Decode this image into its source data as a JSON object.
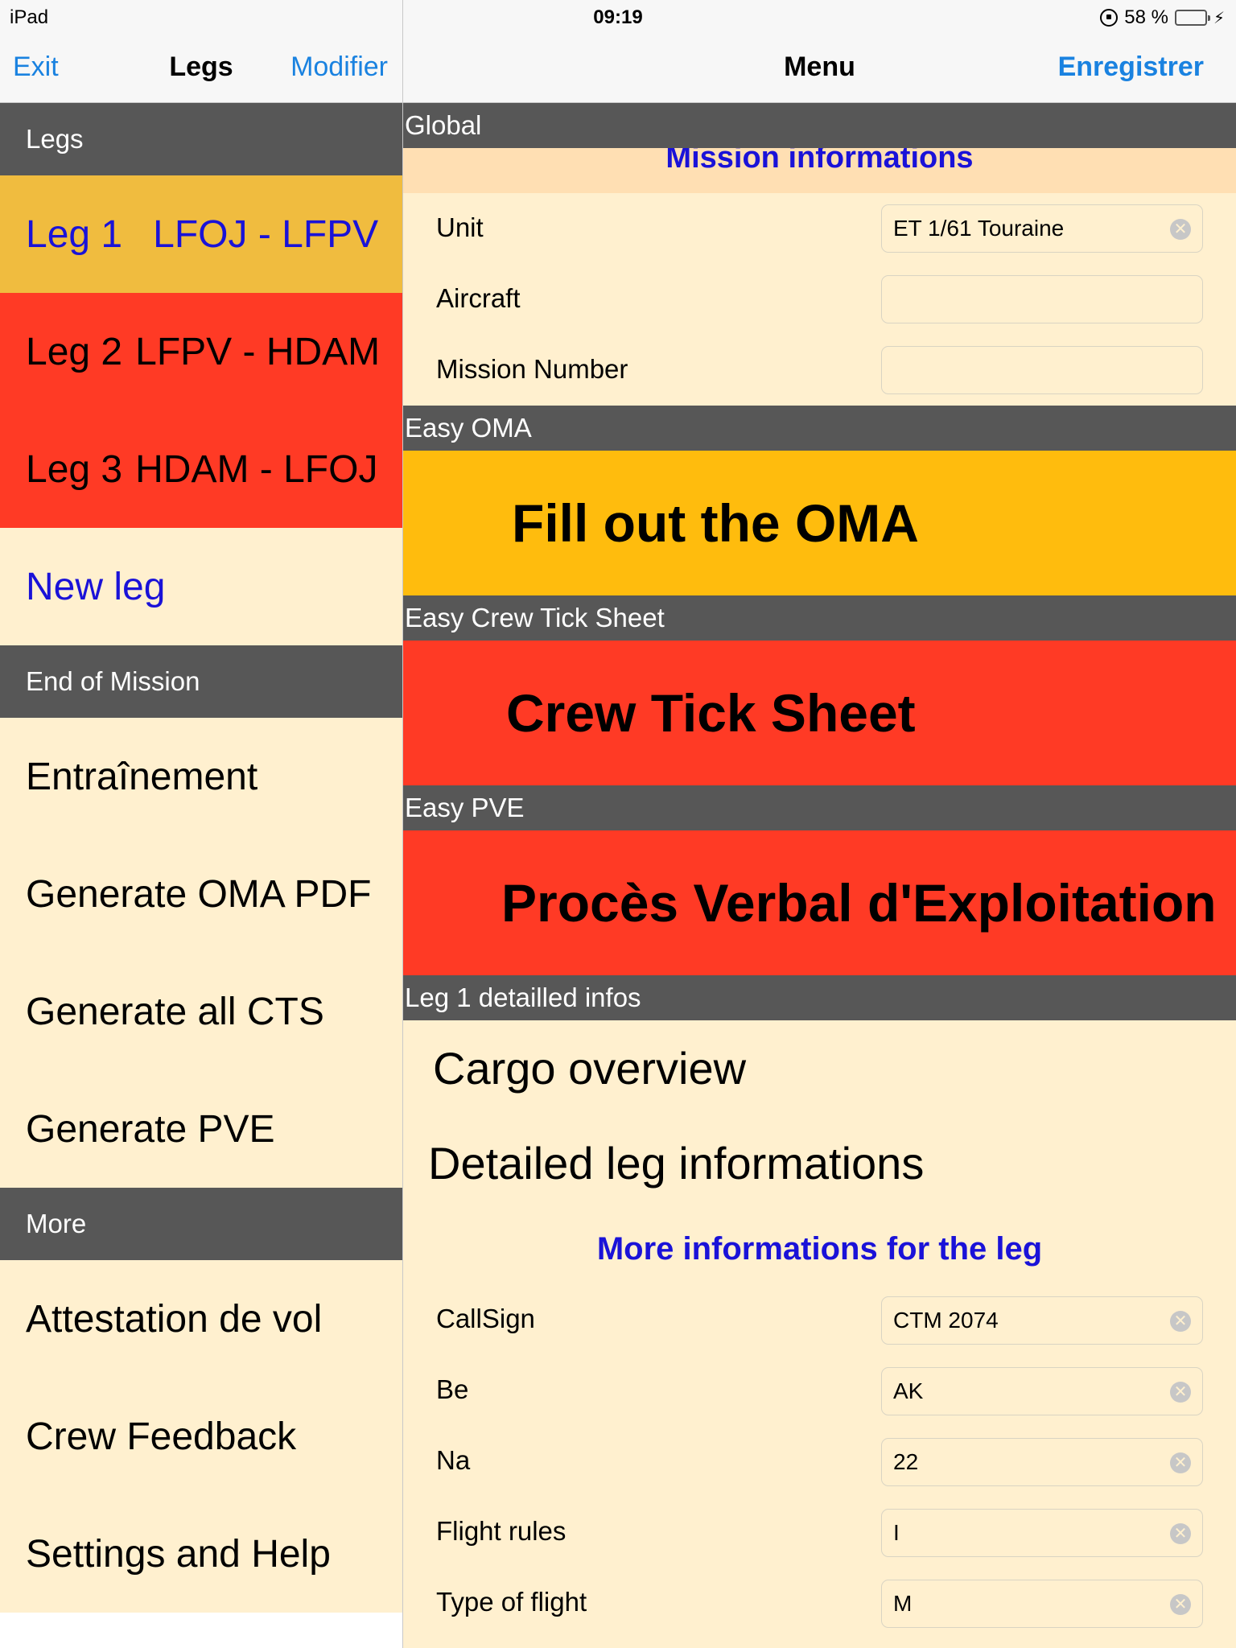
{
  "status": {
    "device": "iPad",
    "time": "09:19",
    "battery": "58 %"
  },
  "left_nav": {
    "exit": "Exit",
    "title": "Legs",
    "modify": "Modifier"
  },
  "right_nav": {
    "title": "Menu",
    "save": "Enregistrer"
  },
  "left": {
    "legs_header": "Legs",
    "legs": [
      {
        "num": "Leg 1",
        "route": "LFOJ - LFPV",
        "status_color": "#f0bc3f"
      },
      {
        "num": "Leg 2",
        "route": "LFPV - HDAM",
        "status_color": "#ff3a25"
      },
      {
        "num": "Leg 3",
        "route": "HDAM - LFOJ",
        "status_color": "#ff3a25"
      }
    ],
    "new_leg": "New leg",
    "end_header": "End of Mission",
    "end_items": [
      "Entraînement",
      "Generate OMA PDF",
      "Generate all CTS",
      "Generate PVE"
    ],
    "more_header": "More",
    "more_items": [
      "Attestation de vol",
      "Crew Feedback",
      "Settings and Help"
    ]
  },
  "right": {
    "global_header": "Global",
    "mission_title": "Mission informations",
    "unit_label": "Unit",
    "unit_value": "ET 1/61 Touraine",
    "aircraft_label": "Aircraft",
    "aircraft_value": "",
    "mission_number_label": "Mission Number",
    "mission_number_value": "",
    "oma_header": "Easy OMA",
    "oma_button": "Fill out the OMA",
    "cts_header": "Easy Crew Tick Sheet",
    "cts_button": "Crew Tick Sheet",
    "pve_header": "Easy PVE",
    "pve_button": "Procès Verbal d'Exploitation",
    "leg_header": "Leg 1 detailled infos",
    "cargo": "Cargo overview",
    "detailed": "Detailed leg informations",
    "more_info": "More informations for the leg",
    "fields": [
      {
        "label": "CallSign",
        "value": "CTM 2074"
      },
      {
        "label": "Be",
        "value": "AK"
      },
      {
        "label": "Na",
        "value": "22"
      },
      {
        "label": "Flight rules",
        "value": "I"
      },
      {
        "label": "Type of flight",
        "value": "M"
      }
    ]
  },
  "colors": {
    "accent": "#1a82e0",
    "link_blue": "#1a12d8",
    "header_gray": "#575757",
    "cream": "#fff0cf",
    "orange": "#ffbc0d",
    "red": "#ff3a25"
  }
}
